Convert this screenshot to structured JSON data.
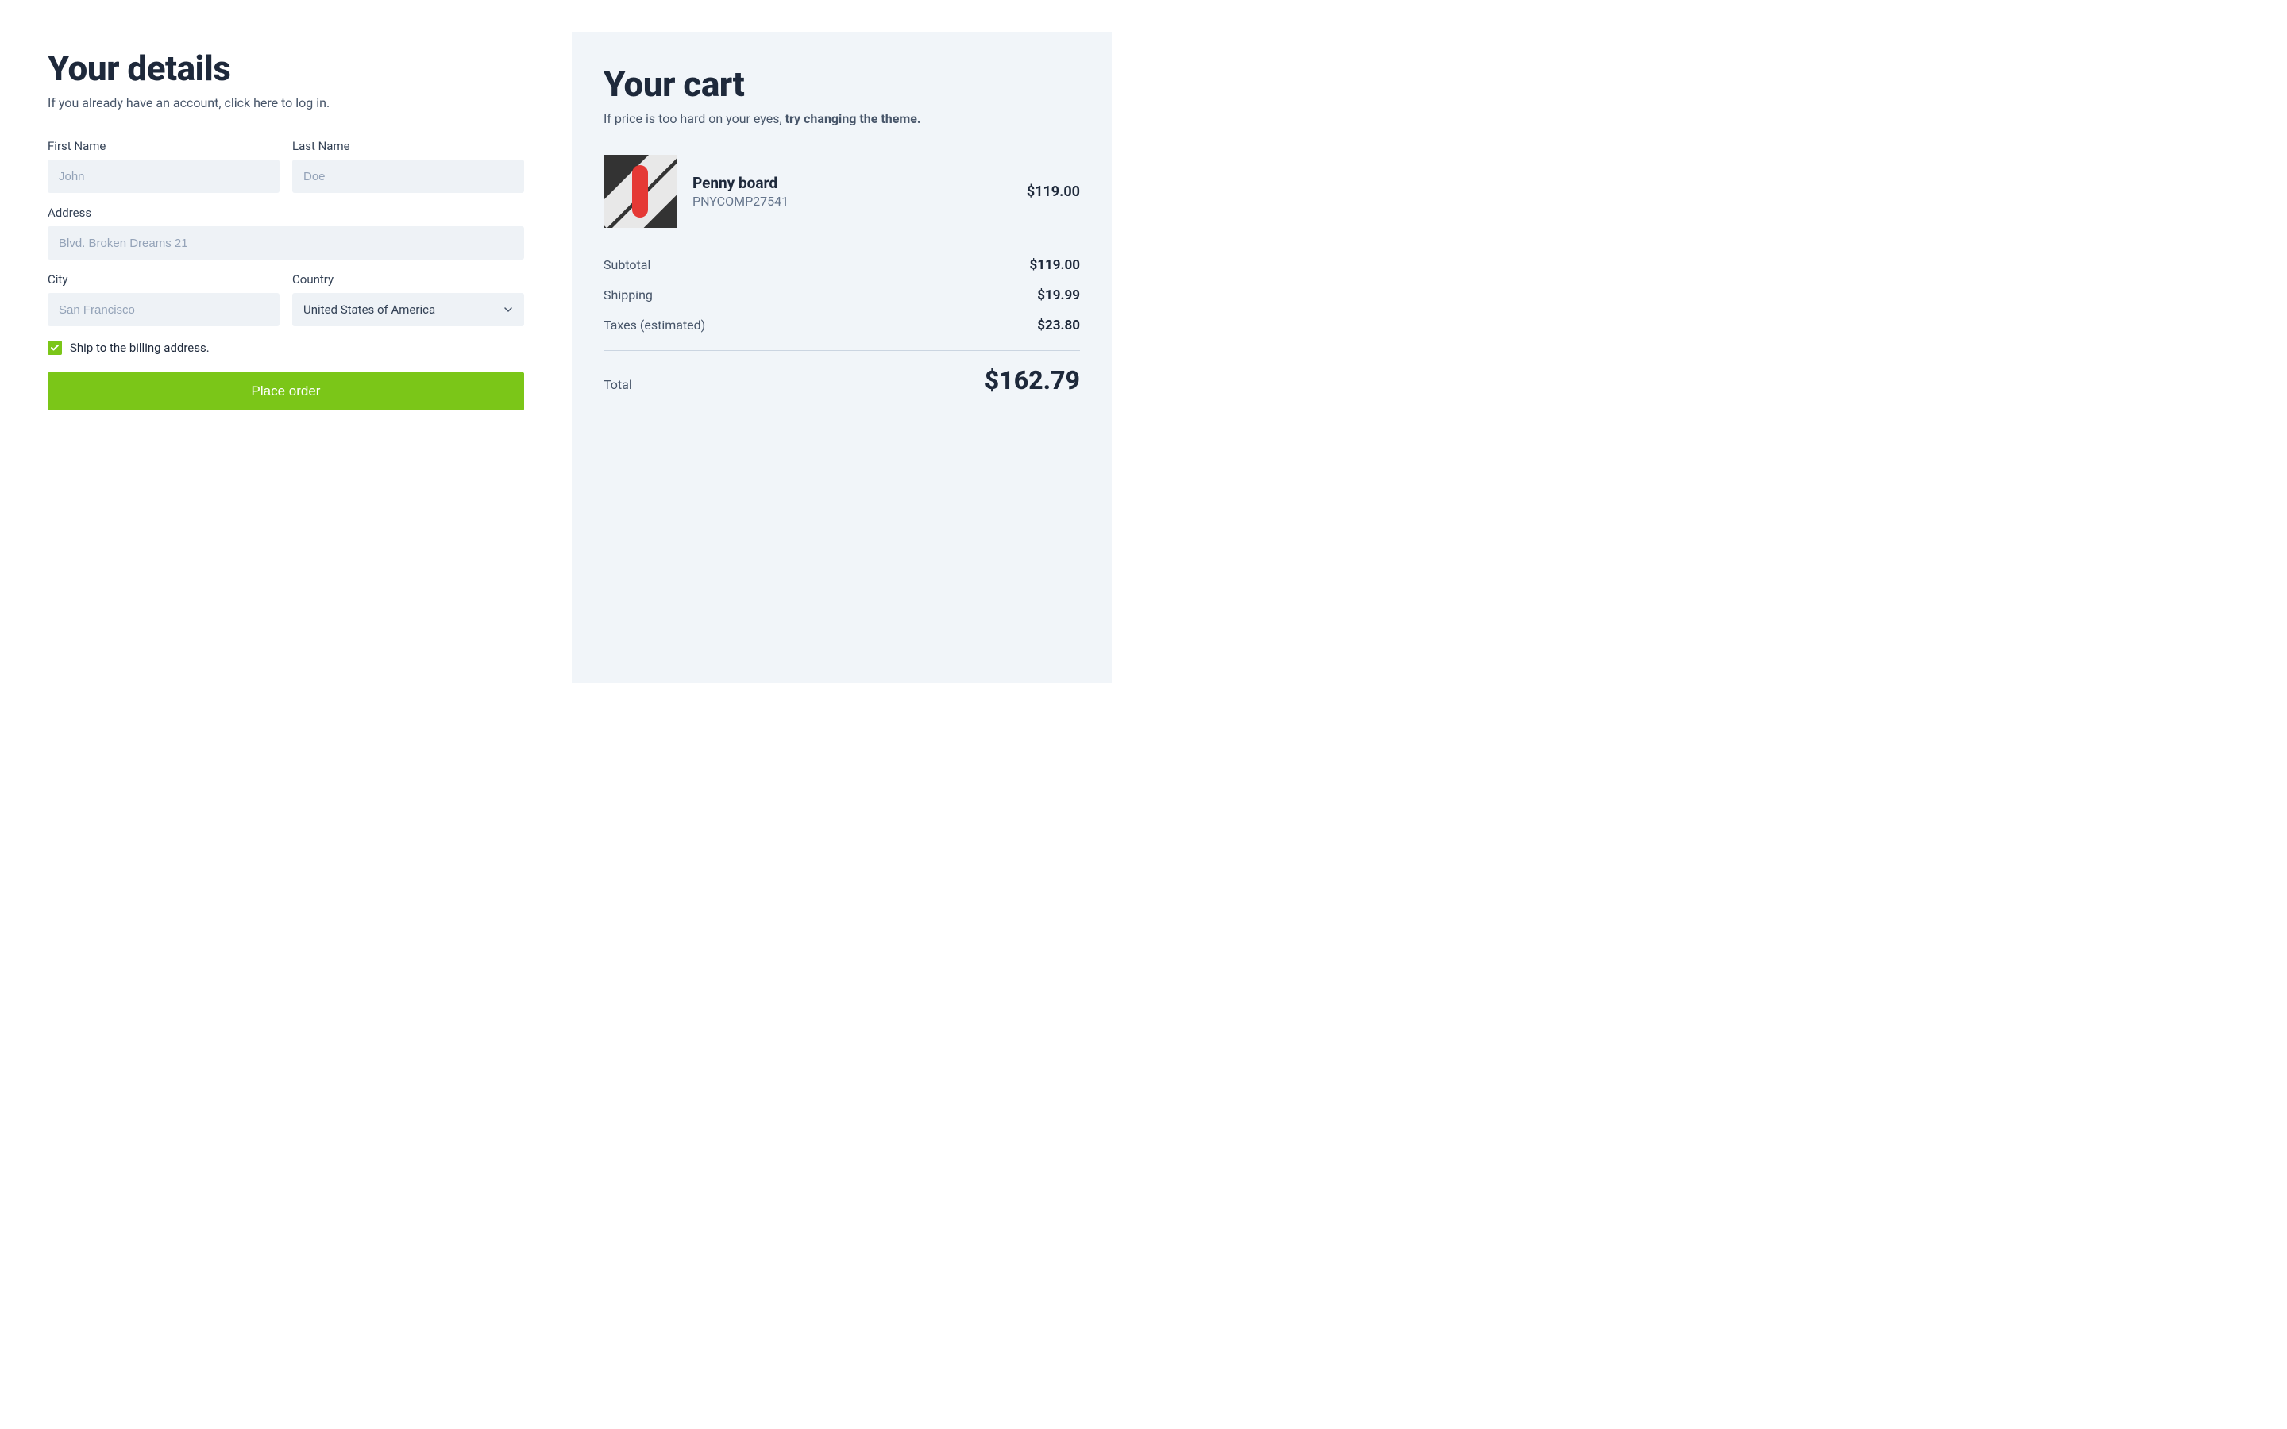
{
  "details": {
    "heading": "Your details",
    "subtitle": "If you already have an account, click here to log in.",
    "firstName": {
      "label": "First Name",
      "placeholder": "John",
      "value": ""
    },
    "lastName": {
      "label": "Last Name",
      "placeholder": "Doe",
      "value": ""
    },
    "address": {
      "label": "Address",
      "placeholder": "Blvd. Broken Dreams 21",
      "value": ""
    },
    "city": {
      "label": "City",
      "placeholder": "San Francisco",
      "value": ""
    },
    "country": {
      "label": "Country",
      "selected": "United States of America"
    },
    "shipToBilling": {
      "label": "Ship to the billing address.",
      "checked": true
    },
    "submitLabel": "Place order"
  },
  "cart": {
    "heading": "Your cart",
    "subtitlePlain": "If price is too hard on your eyes, ",
    "subtitleBold": "try changing the theme.",
    "item": {
      "name": "Penny board",
      "sku": "PNYCOMP27541",
      "price": "$119.00"
    },
    "subtotal": {
      "label": "Subtotal",
      "value": "$119.00"
    },
    "shipping": {
      "label": "Shipping",
      "value": "$19.99"
    },
    "taxes": {
      "label": "Taxes (estimated)",
      "value": "$23.80"
    },
    "total": {
      "label": "Total",
      "value": "$162.79"
    }
  }
}
